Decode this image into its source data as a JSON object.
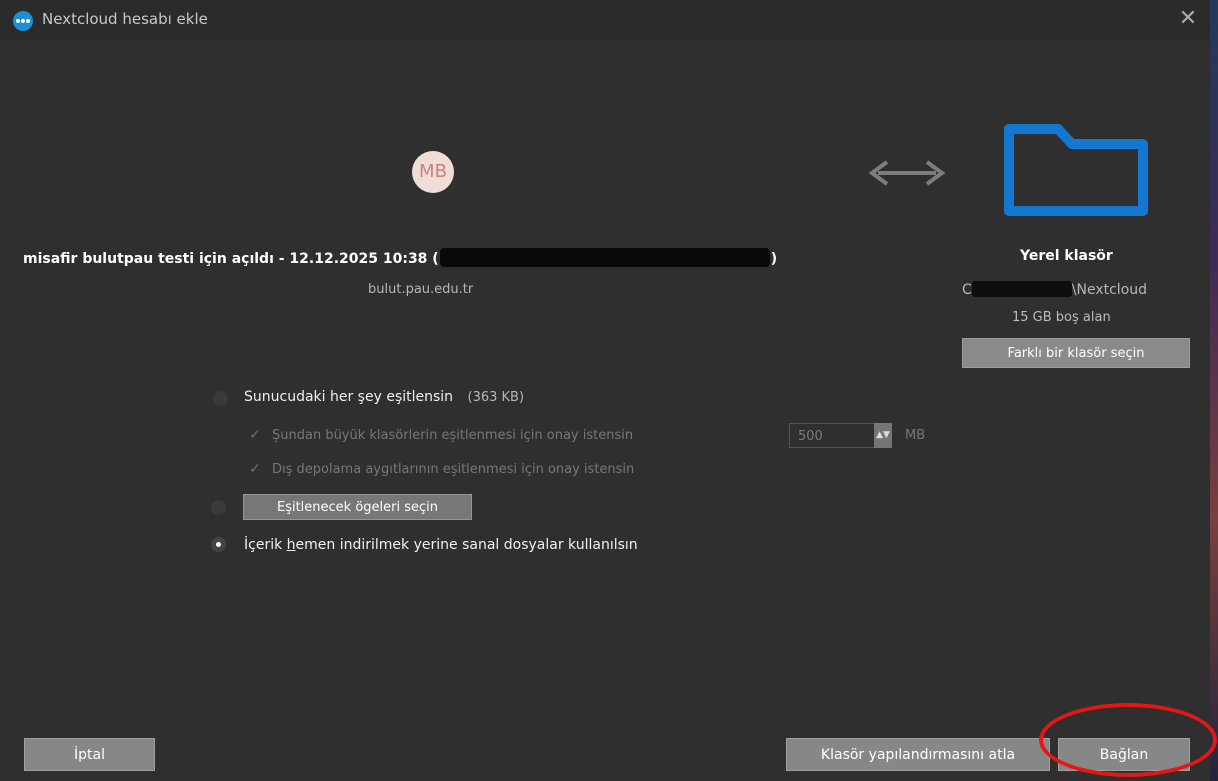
{
  "window": {
    "title": "Nextcloud hesabı ekle",
    "close_glyph": "✕"
  },
  "avatar": {
    "initials": "MB"
  },
  "account": {
    "name_prefix": "misafir bulutpau testi için açıldı - 12.12.2025 10:38 (",
    "name_suffix": ")",
    "server": "bulut.pau.edu.tr"
  },
  "local": {
    "label": "Yerel klasör",
    "path_prefix": "C",
    "path_suffix": "\\Nextcloud",
    "free_space": "15 GB boş alan",
    "choose_folder_label": "Farklı bir klasör seçin"
  },
  "sync_all": {
    "label": "Sunucudaki her şey eşitlensin",
    "size": "(363 KB)",
    "confirm_large_label": "Şundan büyük klasörlerin eşitlenmesi için onay istensin",
    "size_limit_value": "500",
    "size_limit_unit": "MB",
    "confirm_external_label": "Dış depolama aygıtlarının eşitlenmesi için onay istensin",
    "check_glyph": "✓"
  },
  "selective": {
    "button_label": "Eşitlenecek ögeleri seçin"
  },
  "virtual_files": {
    "prefix": "İçerik ",
    "mnemonic": "h",
    "suffix": "emen indirilmek yerine sanal dosyalar kullanılsın"
  },
  "buttons": {
    "cancel": "İptal",
    "skip": "Klasör yapılandırmasını atla",
    "connect": "Bağlan"
  },
  "icons": {
    "app": "nextcloud-logo-icon",
    "avatar": "avatar-icon",
    "sync_direction": "double-arrow-icon",
    "local_folder": "folder-icon"
  },
  "colors": {
    "window_bg": "#2f2f2f",
    "button_bg": "#878787",
    "folder_accent": "#1578d0",
    "highlight_annotation": "#e51616"
  }
}
